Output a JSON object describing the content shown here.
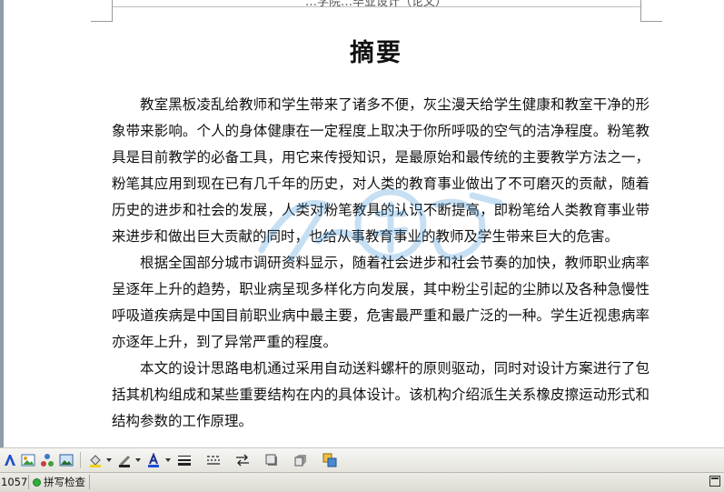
{
  "document": {
    "header_text": "…学院…毕业设计（论文）",
    "title": "摘要",
    "paragraphs": [
      "教室黑板凌乱给教师和学生带来了诸多不便，灰尘漫天给学生健康和教室干净的形象带来影响。个人的身体健康在一定程度上取决于你所呼吸的空气的洁净程度。粉笔教具是目前教学的必备工具，用它来传授知识，是最原始和最传统的主要教学方法之一，粉笔其应用到现在已有几千年的历史，对人类的教育事业做出了不可磨灭的贡献，随着历史的进步和社会的发展，人类对粉笔教具的认识不断提高，即粉笔给人类教育事业带来进步和做出巨大贡献的同时，也给从事教育事业的教师及学生带来巨大的危害。",
      "根据全国部分城市调研资料显示，随着社会进步和社会节奏的加快，教师职业病率呈逐年上升的趋势，职业病呈现多样化方向发展，其中粉尘引起的尘肺以及各种急慢性呼吸道疾病是中国目前职业病中最主要，危害最严重和最广泛的一种。学生近视患病率亦逐年上升，到了异常严重的程度。",
      "本文的设计思路电机通过采用自动送料螺杆的原则驱动，同时对设计方案进行了包括其机构组成和某些重要结构在内的具体设计。该机构介绍派生关系橡皮擦运动形式和结构参数的工作原理。"
    ]
  },
  "drawing_toolbar": {
    "icons": [
      "wordart-icon",
      "clipart-icon",
      "diagram-icon",
      "picture-icon",
      "fill-color-icon",
      "line-color-icon",
      "font-color-icon",
      "line-style-icon",
      "dash-style-icon",
      "arrow-style-icon",
      "shadow-icon",
      "3d-icon",
      "select-objects-icon"
    ],
    "accent_color": "#1f4fd0"
  },
  "status_bar": {
    "word_count": "1057",
    "spell_check_label": "拼写检查"
  },
  "colors": {
    "text": "#111111",
    "toolbar_bg": "#e9e8e2",
    "status_ok": "#2fae3a",
    "watermark": "#3a8fd6"
  }
}
